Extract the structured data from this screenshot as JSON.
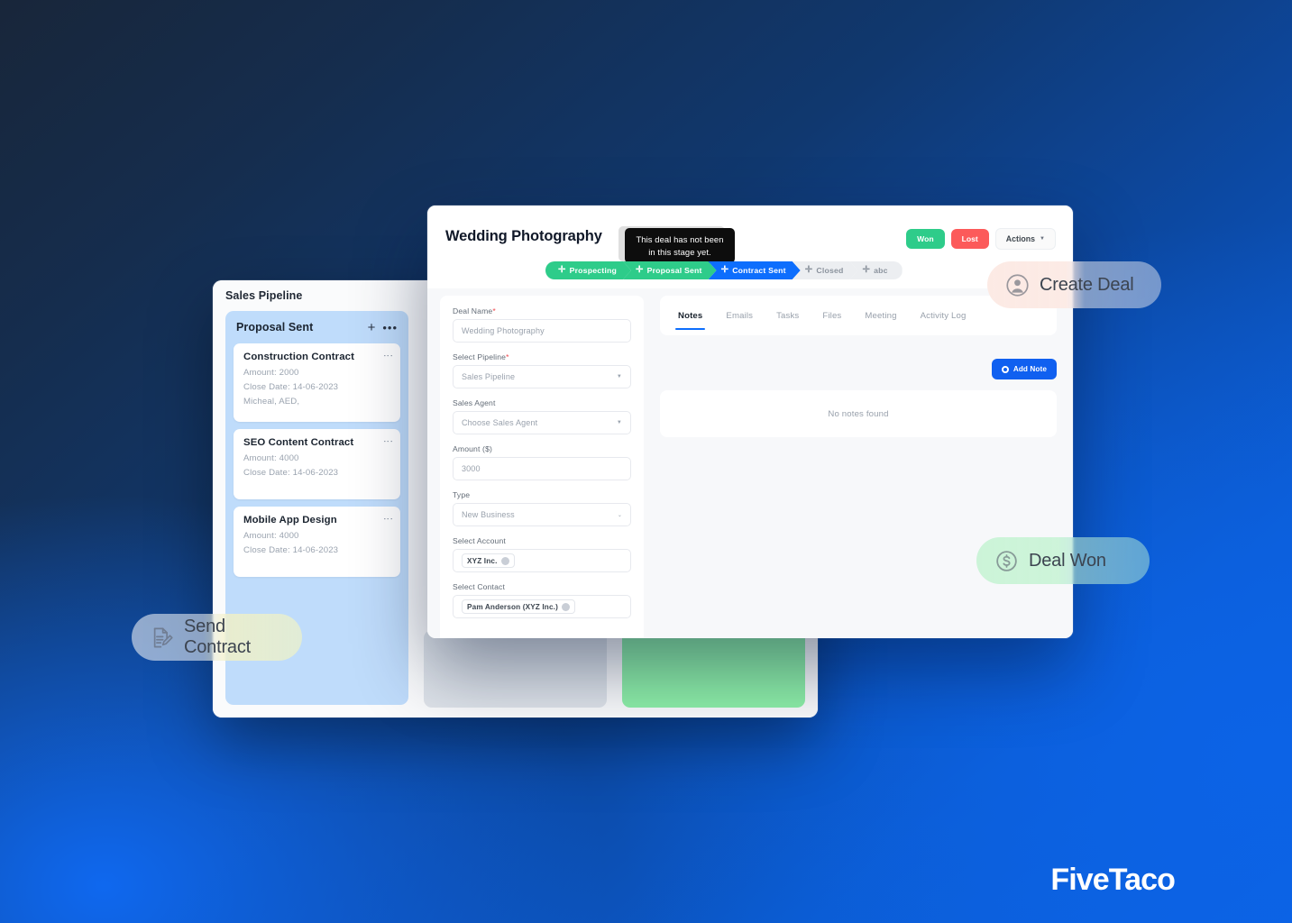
{
  "background": {
    "dark": "#18263a",
    "bright": "#0d63e4"
  },
  "pipeline_window": {
    "title": "Sales Pipeline",
    "columns": [
      {
        "name": "Proposal Sent",
        "add_icon": "plus-icon",
        "more_icon": "ellipsis-icon",
        "cards": [
          {
            "title": "Construction Contract",
            "amount": "Amount: 2000",
            "close_date": "Close Date: 14-06-2023",
            "extra": "Micheal,   AED,"
          },
          {
            "title": "SEO Content Contract",
            "amount": "Amount: 4000",
            "close_date": "Close Date: 14-06-2023",
            "extra": ""
          },
          {
            "title": "Mobile App Design",
            "amount": "Amount: 4000",
            "close_date": "Close Date: 14-06-2023",
            "extra": ""
          }
        ]
      }
    ]
  },
  "deal_window": {
    "deal_title": "Wedding Photography",
    "tooltip": "This deal has not been in this stage yet.",
    "tooltip_ghost": "This deal has not been in this stage yet.",
    "buttons": {
      "won": "Won",
      "lost": "Lost",
      "actions": "Actions",
      "won_color": "#2ecc8a",
      "lost_color": "#fc5a5a"
    },
    "stages": [
      {
        "label": "Prospecting",
        "state": "green"
      },
      {
        "label": "Proposal Sent",
        "state": "green"
      },
      {
        "label": "Contract Sent",
        "state": "blue"
      },
      {
        "label": "Closed",
        "state": "gray"
      },
      {
        "label": "abc",
        "state": "gray"
      }
    ],
    "form": {
      "fields": [
        {
          "label": "Deal Name",
          "required": true,
          "value": "Wedding Photography",
          "control": "input"
        },
        {
          "label": "Select Pipeline",
          "required": true,
          "value": "Sales Pipeline",
          "control": "select"
        },
        {
          "label": "Sales Agent",
          "required": false,
          "value": "Choose Sales Agent",
          "control": "select"
        },
        {
          "label": "Amount ($)",
          "required": false,
          "value": "3000",
          "control": "input"
        },
        {
          "label": "Type",
          "required": false,
          "value": "New Business",
          "control": "select"
        },
        {
          "label": "Select Account",
          "required": false,
          "value": "XYZ Inc.",
          "control": "tag"
        },
        {
          "label": "Select Contact",
          "required": false,
          "value": "Pam Anderson (XYZ Inc.)",
          "control": "tag"
        }
      ]
    },
    "tabs": [
      {
        "label": "Notes",
        "active": true
      },
      {
        "label": "Emails",
        "active": false
      },
      {
        "label": "Tasks",
        "active": false
      },
      {
        "label": "Files",
        "active": false
      },
      {
        "label": "Meeting",
        "active": false
      },
      {
        "label": "Activity Log",
        "active": false
      }
    ],
    "add_note_label": "Add Note",
    "add_note_color": "#1060f0",
    "notes_empty": "No notes found"
  },
  "pills": [
    {
      "label": "Send Contract",
      "icon": "document-pen-icon"
    },
    {
      "label": "Create Deal",
      "icon": "user-circle-icon"
    },
    {
      "label": "Deal Won",
      "icon": "dollar-circle-icon"
    }
  ],
  "logo": "FiveTaco"
}
